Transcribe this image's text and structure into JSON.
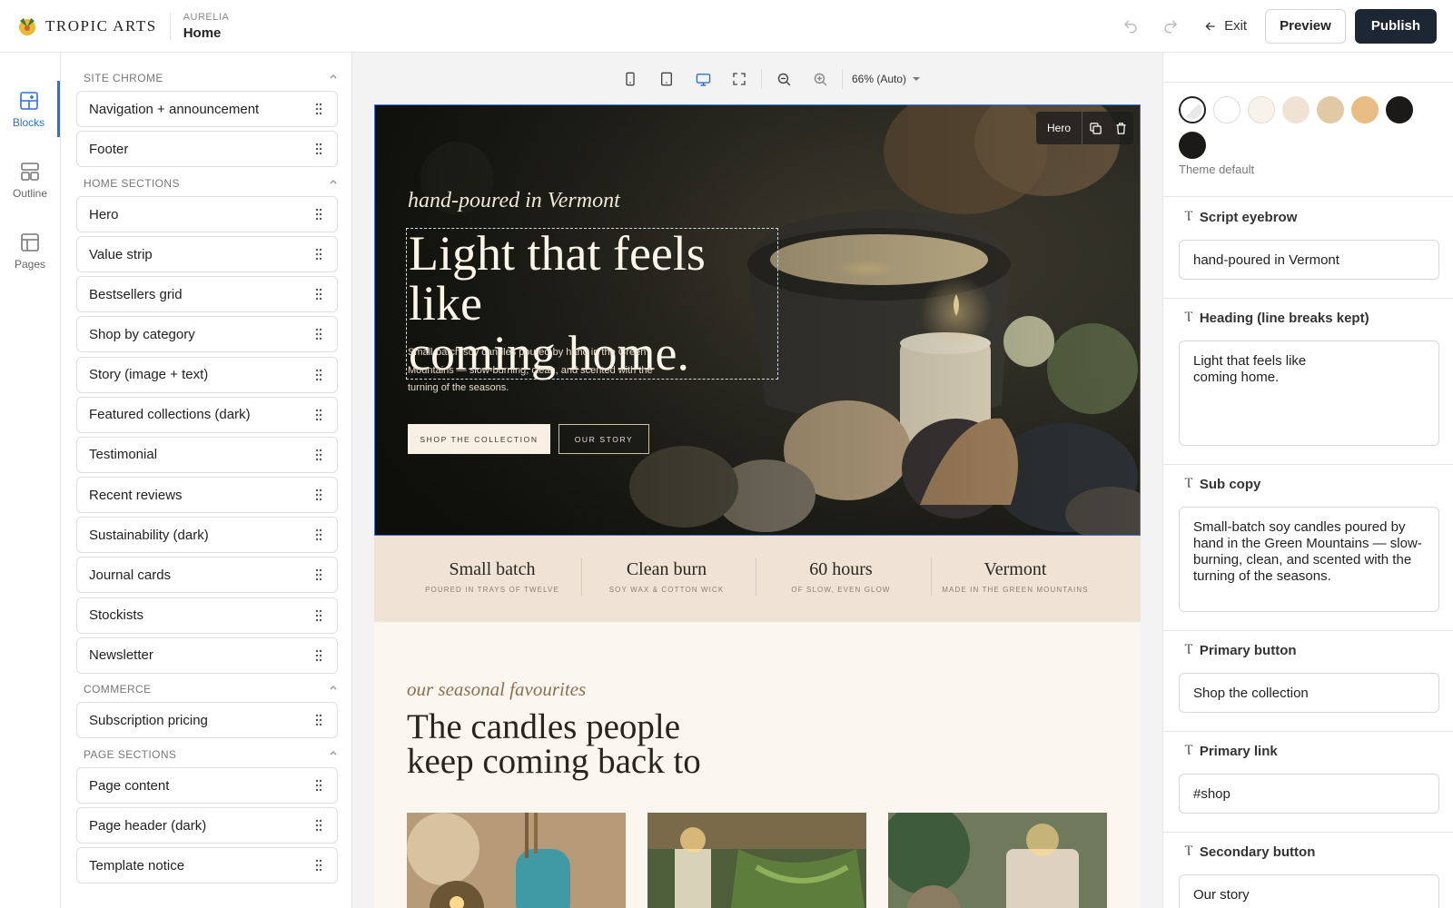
{
  "brand": {
    "name": "TROPIC ARTS"
  },
  "breadcrumb": {
    "site": "AURELIA",
    "page": "Home"
  },
  "topbar": {
    "exit_label": "Exit",
    "preview_label": "Preview",
    "publish_label": "Publish"
  },
  "rail": {
    "items": [
      {
        "label": "Blocks",
        "icon": "blocks-icon",
        "active": true
      },
      {
        "label": "Outline",
        "icon": "outline-icon"
      },
      {
        "label": "Pages",
        "icon": "pages-icon"
      }
    ]
  },
  "blocks_panel": {
    "groups": [
      {
        "title": "SITE CHROME",
        "items": [
          "Navigation + announcement",
          "Footer"
        ]
      },
      {
        "title": "HOME SECTIONS",
        "items": [
          "Hero",
          "Value strip",
          "Bestsellers grid",
          "Shop by category",
          "Story (image + text)",
          "Featured collections (dark)",
          "Testimonial",
          "Recent reviews",
          "Sustainability (dark)",
          "Journal cards",
          "Stockists",
          "Newsletter"
        ]
      },
      {
        "title": "COMMERCE",
        "items": [
          "Subscription pricing"
        ]
      },
      {
        "title": "PAGE SECTIONS",
        "items": [
          "Page content",
          "Page header (dark)",
          "Template notice"
        ]
      }
    ]
  },
  "canvas": {
    "zoom_label": "66% (Auto)",
    "hero": {
      "tag_label": "Hero",
      "eyebrow": "hand-poured in Vermont",
      "heading": "Light that feels like\ncoming home.",
      "sub_copy": "Small-batch soy candles poured by hand in the Green Mountains — slow-burning, clean, and scented with the turning of the seasons.",
      "primary_button": "SHOP THE COLLECTION",
      "secondary_button": "OUR STORY"
    },
    "value_strip": [
      {
        "title": "Small batch",
        "sub": "POURED IN TRAYS OF TWELVE"
      },
      {
        "title": "Clean burn",
        "sub": "SOY WAX & COTTON WICK"
      },
      {
        "title": "60 hours",
        "sub": "OF SLOW, EVEN GLOW"
      },
      {
        "title": "Vermont",
        "sub": "MADE IN THE GREEN MOUNTAINS"
      }
    ],
    "bestsellers": {
      "script": "our seasonal favourites",
      "heading": "The candles people\nkeep coming back to"
    }
  },
  "inspector": {
    "swatches": [
      "#ffffff",
      "#ffffff",
      "#f8f3ea",
      "#f0e3d3",
      "#e2c9a5",
      "#e8bd84",
      "#1c1a18",
      "#1c1a18"
    ],
    "theme_label": "Theme default",
    "fields": {
      "eyebrow_label": "Script eyebrow",
      "eyebrow_value": "hand-poured in Vermont",
      "heading_label": "Heading (line breaks kept)",
      "heading_value": "Light that feels like\ncoming home.",
      "sub_label": "Sub copy",
      "sub_value": "Small-batch soy candles poured by hand in the Green Mountains — slow-burning, clean, and scented with the turning of the seasons.",
      "primary_button_label": "Primary button",
      "primary_button_value": "Shop the collection",
      "primary_link_label": "Primary link",
      "primary_link_value": "#shop",
      "secondary_button_label": "Secondary button",
      "secondary_button_value": "Our story"
    }
  }
}
